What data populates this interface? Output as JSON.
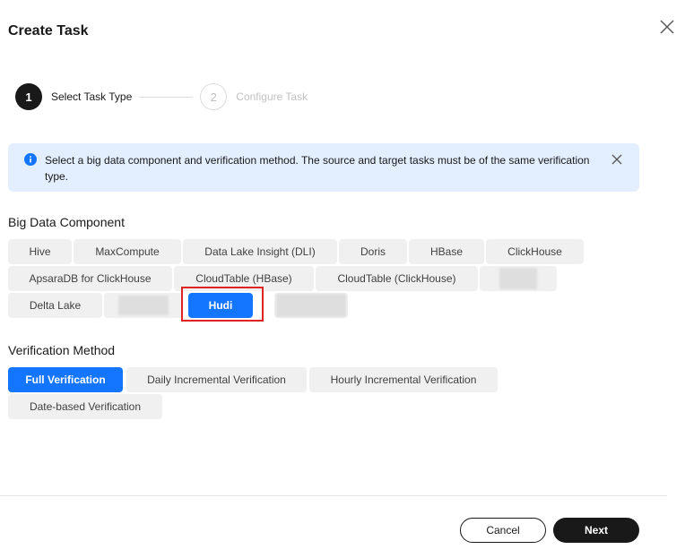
{
  "dialog": {
    "title": "Create Task"
  },
  "steps": [
    {
      "number": "1",
      "label": "Select Task Type"
    },
    {
      "number": "2",
      "label": "Configure Task"
    }
  ],
  "alert": {
    "message": "Select a big data component and verification method. The source and target tasks must be of the same verification type."
  },
  "component": {
    "title": "Big Data Component",
    "selected": "Hudi",
    "items": [
      "Hive",
      "MaxCompute",
      "Data Lake Insight (DLI)",
      "Doris",
      "HBase",
      "ClickHouse",
      "ApsaraDB for ClickHouse",
      "CloudTable (HBase)",
      "CloudTable (ClickHouse)",
      "",
      "Delta Lake",
      "",
      "Hudi",
      ""
    ]
  },
  "verification": {
    "title": "Verification Method",
    "selected": "Full Verification",
    "items": [
      "Full Verification",
      "Daily Incremental Verification",
      "Hourly Incremental Verification",
      "Date-based Verification"
    ]
  },
  "footer": {
    "cancel_label": "Cancel",
    "next_label": "Next"
  },
  "colors": {
    "accent": "#1476ff",
    "dark": "#191919",
    "alert_bg": "#e3efff",
    "highlight": "#e02424"
  },
  "icons": {
    "close": "close-icon",
    "info": "info-icon"
  }
}
